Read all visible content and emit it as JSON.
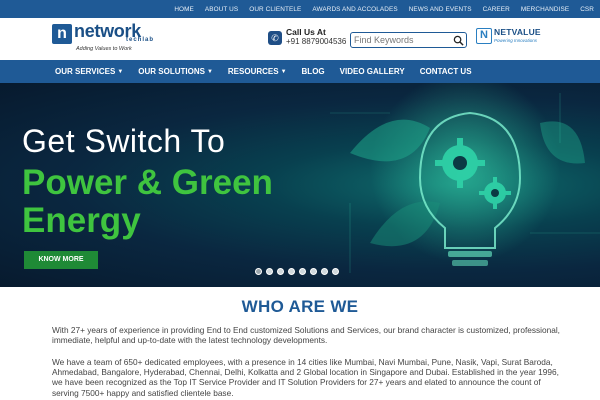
{
  "topbar": {
    "links": [
      "HOME",
      "ABOUT US",
      "OUR CLIENTELE",
      "AWARDS AND ACCOLADES",
      "NEWS AND EVENTS",
      "Career",
      "MERCHANDISE",
      "CSR"
    ]
  },
  "header": {
    "logo": {
      "box": "n",
      "name": "network",
      "sub": "techlab",
      "tagline": "Adding Values to Work"
    },
    "call": {
      "label": "Call Us At",
      "number": "+91 8879004536"
    },
    "search": {
      "placeholder": "Find Keywords"
    },
    "partner": {
      "mark": "N",
      "name": "NETVALUE",
      "tagline": "Powering Innovations"
    }
  },
  "nav": {
    "items": [
      {
        "label": "OUR SERVICES",
        "has_dropdown": true
      },
      {
        "label": "OUR SOLUTIONS",
        "has_dropdown": true
      },
      {
        "label": "RESOURCES",
        "has_dropdown": true
      },
      {
        "label": "BLOG",
        "has_dropdown": false
      },
      {
        "label": "VIDEO GALLERY",
        "has_dropdown": false
      },
      {
        "label": "CONTACT US",
        "has_dropdown": false
      }
    ]
  },
  "hero": {
    "line1": "Get Switch To",
    "line2": "Power & Green",
    "line3": "Energy",
    "button": "KNOW MORE",
    "slide_count": 8,
    "active_slide": 0
  },
  "about": {
    "title": "WHO ARE WE",
    "p1": "With 27+ years of experience in providing End to End customized Solutions and Services, our brand character is customized, professional, immediate, helpful and up-to-date with the latest technology developments.",
    "p2": "We have a team of 650+ dedicated employees, with a presence in 14 cities like Mumbai, Navi Mumbai, Pune, Nasik, Vapi, Surat Baroda, Ahmedabad, Bangalore, Hyderabad, Chennai, Delhi, Kolkatta and 2 Global location in Singapore and Dubai. Established in the year 1996, we have been recognized as the Top IT Service Provider and IT Solution Providers for 27+ years and elated to announce the count of serving 7500+ happy and satisfied clientele base."
  },
  "colors": {
    "brand_blue": "#1f5a96",
    "green": "#3fc43f",
    "button_green": "#1f8a36"
  }
}
